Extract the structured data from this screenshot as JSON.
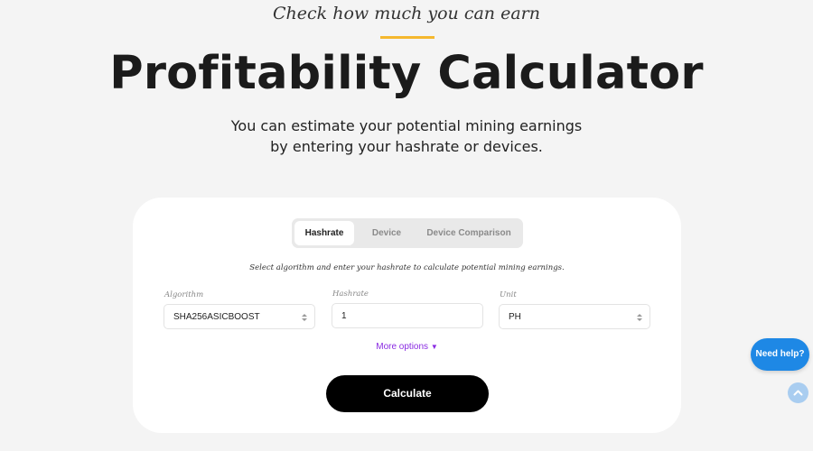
{
  "header": {
    "kicker": "Check how much you can earn",
    "title": "Profitability Calculator",
    "subtitle": "You can estimate your potential mining earnings by entering your hashrate or devices."
  },
  "colors": {
    "accent": "#f5b82e",
    "primary_button": "#000000",
    "link": "#8a2be2",
    "help_button": "#1e88e5"
  },
  "calculator": {
    "tabs": [
      {
        "label": "Hashrate",
        "active": true
      },
      {
        "label": "Device",
        "active": false
      },
      {
        "label": "Device Comparison",
        "active": false
      }
    ],
    "instruction": "Select algorithm and enter your hashrate to calculate potential mining earnings.",
    "fields": {
      "algorithm": {
        "label": "Algorithm",
        "value": "SHA256ASICBOOST",
        "icon": "updown-chevron-icon"
      },
      "hashrate": {
        "label": "Hashrate",
        "value": "1"
      },
      "unit": {
        "label": "Unit",
        "value": "PH",
        "icon": "updown-chevron-icon"
      }
    },
    "more_options": "More options",
    "calculate_label": "Calculate"
  },
  "widgets": {
    "help_label": "Need help?",
    "scroll_top_icon": "chevron-up-icon"
  }
}
